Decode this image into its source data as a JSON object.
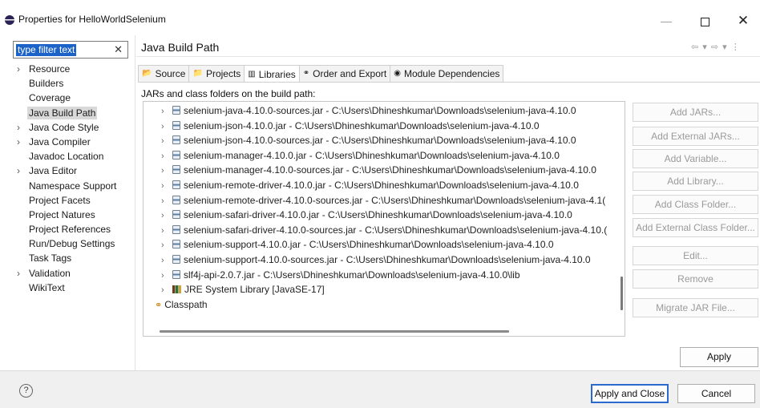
{
  "window": {
    "title": "Properties for HelloWorldSelenium",
    "minimize": "—",
    "close": "✕"
  },
  "filter": {
    "value": "type filter text",
    "clear": "✕"
  },
  "nav": {
    "items": [
      {
        "label": "Resource",
        "expandable": true
      },
      {
        "label": "Builders",
        "expandable": false
      },
      {
        "label": "Coverage",
        "expandable": false
      },
      {
        "label": "Java Build Path",
        "expandable": false,
        "selected": true
      },
      {
        "label": "Java Code Style",
        "expandable": true
      },
      {
        "label": "Java Compiler",
        "expandable": true
      },
      {
        "label": "Javadoc Location",
        "expandable": false
      },
      {
        "label": "Java Editor",
        "expandable": true
      },
      {
        "label": "Namespace Support",
        "expandable": false
      },
      {
        "label": "Project Facets",
        "expandable": false
      },
      {
        "label": "Project Natures",
        "expandable": false
      },
      {
        "label": "Project References",
        "expandable": false
      },
      {
        "label": "Run/Debug Settings",
        "expandable": false
      },
      {
        "label": "Task Tags",
        "expandable": false
      },
      {
        "label": "Validation",
        "expandable": true
      },
      {
        "label": "WikiText",
        "expandable": false
      }
    ]
  },
  "page": {
    "title": "Java Build Path",
    "nav_arrows": "⇦ ▾ ⇨ ▾ ⋮"
  },
  "tabs": [
    {
      "label": "Source",
      "icon": "source-folder-icon",
      "glyph": "📂",
      "active": false
    },
    {
      "label": "Projects",
      "icon": "projects-icon",
      "glyph": "📁",
      "active": false
    },
    {
      "label": "Libraries",
      "icon": "libraries-icon",
      "glyph": "▥",
      "active": true
    },
    {
      "label": "Order and Export",
      "icon": "order-export-icon",
      "glyph": "⚭",
      "active": false
    },
    {
      "label": "Module Dependencies",
      "icon": "module-dependencies-icon",
      "glyph": "◉",
      "active": false
    }
  ],
  "libraries": {
    "section_label": "JARs and class folders on the build path:",
    "entries": [
      {
        "text": "selenium-java-4.10.0-sources.jar - C:\\Users\\Dhineshkumar\\Downloads\\selenium-java-4.10.0",
        "icon": "jar-icon"
      },
      {
        "text": "selenium-json-4.10.0.jar - C:\\Users\\Dhineshkumar\\Downloads\\selenium-java-4.10.0",
        "icon": "jar-icon"
      },
      {
        "text": "selenium-json-4.10.0-sources.jar - C:\\Users\\Dhineshkumar\\Downloads\\selenium-java-4.10.0",
        "icon": "jar-icon"
      },
      {
        "text": "selenium-manager-4.10.0.jar - C:\\Users\\Dhineshkumar\\Downloads\\selenium-java-4.10.0",
        "icon": "jar-icon"
      },
      {
        "text": "selenium-manager-4.10.0-sources.jar - C:\\Users\\Dhineshkumar\\Downloads\\selenium-java-4.10.0",
        "icon": "jar-icon"
      },
      {
        "text": "selenium-remote-driver-4.10.0.jar - C:\\Users\\Dhineshkumar\\Downloads\\selenium-java-4.10.0",
        "icon": "jar-icon"
      },
      {
        "text": "selenium-remote-driver-4.10.0-sources.jar - C:\\Users\\Dhineshkumar\\Downloads\\selenium-java-4.1(",
        "icon": "jar-icon"
      },
      {
        "text": "selenium-safari-driver-4.10.0.jar - C:\\Users\\Dhineshkumar\\Downloads\\selenium-java-4.10.0",
        "icon": "jar-icon"
      },
      {
        "text": "selenium-safari-driver-4.10.0-sources.jar - C:\\Users\\Dhineshkumar\\Downloads\\selenium-java-4.10.(",
        "icon": "jar-icon"
      },
      {
        "text": "selenium-support-4.10.0.jar - C:\\Users\\Dhineshkumar\\Downloads\\selenium-java-4.10.0",
        "icon": "jar-icon"
      },
      {
        "text": "selenium-support-4.10.0-sources.jar - C:\\Users\\Dhineshkumar\\Downloads\\selenium-java-4.10.0",
        "icon": "jar-icon"
      },
      {
        "text": "slf4j-api-2.0.7.jar - C:\\Users\\Dhineshkumar\\Downloads\\selenium-java-4.10.0\\lib",
        "icon": "jar-icon"
      },
      {
        "text": "JRE System Library [JavaSE-17]",
        "icon": "library-icon"
      }
    ],
    "classpath_label": "Classpath"
  },
  "side_buttons": [
    {
      "label": "Add JARs...",
      "enabled": false
    },
    {
      "label": "Add External JARs...",
      "enabled": false
    },
    {
      "label": "Add Variable...",
      "enabled": false
    },
    {
      "label": "Add Library...",
      "enabled": false
    },
    {
      "label": "Add Class Folder...",
      "enabled": false
    },
    {
      "label": "Add External Class Folder...",
      "enabled": false
    },
    {
      "label": "Edit...",
      "enabled": false
    },
    {
      "label": "Remove",
      "enabled": false
    },
    {
      "label": "Migrate JAR File...",
      "enabled": false
    }
  ],
  "apply_label": "Apply",
  "footer": {
    "help": "?",
    "apply_close_label": "Apply and Close",
    "cancel_label": "Cancel"
  },
  "colors": {
    "selection": "#1c63c9",
    "default_button_border": "#2a6ad0",
    "disabled_text": "#9a9a9a"
  }
}
